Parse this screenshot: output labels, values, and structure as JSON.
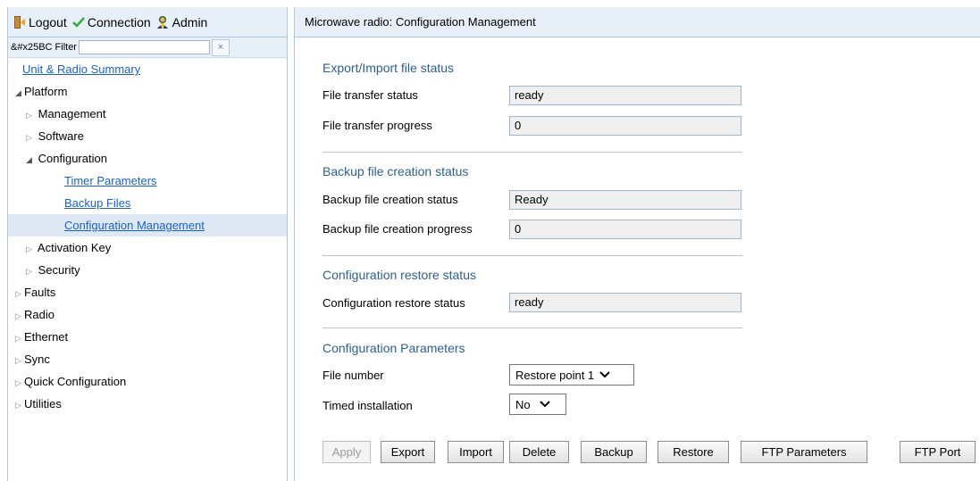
{
  "topbar": {
    "logout_label": "Logout",
    "connection_label": "Connection",
    "admin_label": "Admin"
  },
  "filter": {
    "label": "&#x25BC Filter",
    "value": "",
    "clear_symbol": "×"
  },
  "tree": {
    "unit_summary": "Unit & Radio Summary",
    "platform": "Platform",
    "management": "Management",
    "software": "Software",
    "configuration": "Configuration",
    "timer_parameters": "Timer Parameters",
    "backup_files": "Backup Files",
    "configuration_management": "Configuration Management",
    "activation_key": "Activation Key",
    "security": "Security",
    "faults": "Faults",
    "radio": "Radio",
    "ethernet": "Ethernet",
    "sync": "Sync",
    "quick_configuration": "Quick Configuration",
    "utilities": "Utilities"
  },
  "main": {
    "header_title": "Microwave radio: Configuration Management",
    "export_import": {
      "title": "Export/Import file status",
      "transfer_status_label": "File transfer status",
      "transfer_status_value": "ready",
      "transfer_progress_label": "File transfer progress",
      "transfer_progress_value": "0"
    },
    "backup": {
      "title": "Backup file creation status",
      "status_label": "Backup file creation status",
      "status_value": "Ready",
      "progress_label": "Backup file creation progress",
      "progress_value": "0"
    },
    "restore": {
      "title": "Configuration restore status",
      "status_label": "Configuration restore status",
      "status_value": "ready"
    },
    "params": {
      "title": "Configuration Parameters",
      "file_number_label": "File number",
      "file_number_value": "Restore point 1",
      "timed_label": "Timed installation",
      "timed_value": "No"
    },
    "buttons": {
      "apply": "Apply",
      "export": "Export",
      "import": "Import",
      "delete": "Delete",
      "backup": "Backup",
      "restore": "Restore",
      "ftp_parameters": "FTP Parameters",
      "ftp_port": "FTP Port"
    }
  },
  "colors": {
    "panel_header_bg": "#e7f0f9",
    "section_title": "#2c5f91",
    "link": "#1a62c9",
    "selected_row": "#dde8f4"
  }
}
